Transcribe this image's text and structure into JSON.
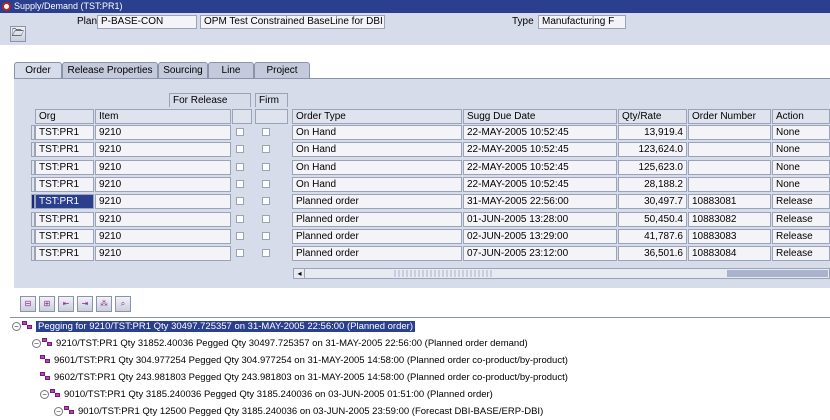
{
  "window": {
    "title": "Supply/Demand (TST:PR1)"
  },
  "header": {
    "plan_label": "Plan",
    "plan_value": "P-BASE-CON",
    "plan_desc": "OPM Test Constrained BaseLine for DBI",
    "type_label": "Type",
    "type_value": "Manufacturing F"
  },
  "tabs": [
    {
      "label": "Order",
      "active": true
    },
    {
      "label": "Release Properties",
      "active": false
    },
    {
      "label": "Sourcing",
      "active": false
    },
    {
      "label": "Line",
      "active": false
    },
    {
      "label": "Project",
      "active": false
    }
  ],
  "groups": {
    "for_release": "For Release",
    "firm": "Firm"
  },
  "columns": {
    "org": "Org",
    "item": "Item",
    "order_type": "Order Type",
    "sugg_due_date": "Sugg Due Date",
    "qty_rate": "Qty/Rate",
    "order_number": "Order Number",
    "action": "Action"
  },
  "rows": [
    {
      "org": "TST:PR1",
      "item": "9210",
      "order_type": "On Hand",
      "sugg_due_date": "22-MAY-2005 10:52:45",
      "qty_rate": "13,919.4",
      "order_number": "",
      "action": "None"
    },
    {
      "org": "TST:PR1",
      "item": "9210",
      "order_type": "On Hand",
      "sugg_due_date": "22-MAY-2005 10:52:45",
      "qty_rate": "123,624.0",
      "order_number": "",
      "action": "None"
    },
    {
      "org": "TST:PR1",
      "item": "9210",
      "order_type": "On Hand",
      "sugg_due_date": "22-MAY-2005 10:52:45",
      "qty_rate": "125,623.0",
      "order_number": "",
      "action": "None"
    },
    {
      "org": "TST:PR1",
      "item": "9210",
      "order_type": "On Hand",
      "sugg_due_date": "22-MAY-2005 10:52:45",
      "qty_rate": "28,188.2",
      "order_number": "",
      "action": "None"
    },
    {
      "org": "TST:PR1",
      "item": "9210",
      "order_type": "Planned order",
      "sugg_due_date": "31-MAY-2005 22:56:00",
      "qty_rate": "30,497.7",
      "order_number": "10883081",
      "action": "Release",
      "current": true
    },
    {
      "org": "TST:PR1",
      "item": "9210",
      "order_type": "Planned order",
      "sugg_due_date": "01-JUN-2005 13:28:00",
      "qty_rate": "50,450.4",
      "order_number": "10883082",
      "action": "Release"
    },
    {
      "org": "TST:PR1",
      "item": "9210",
      "order_type": "Planned order",
      "sugg_due_date": "02-JUN-2005 13:29:00",
      "qty_rate": "41,787.6",
      "order_number": "10883083",
      "action": "Release"
    },
    {
      "org": "TST:PR1",
      "item": "9210",
      "order_type": "Planned order",
      "sugg_due_date": "07-JUN-2005 23:12:00",
      "qty_rate": "36,501.6",
      "order_number": "10883084",
      "action": "Release"
    }
  ],
  "toolbar_icons": [
    "tree-collapse-icon",
    "tree-expand-icon",
    "pegging-up-icon",
    "pegging-down-icon",
    "pegging-all-icon",
    "pegging-find-icon"
  ],
  "tree": [
    {
      "text": "Pegging for 9210/TST:PR1 Qty 30497.725357 on 31-MAY-2005 22:56:00 (Planned order)",
      "level": 0,
      "expander": "−",
      "selected": true
    },
    {
      "text": "9210/TST:PR1 Qty 31852.40036 Pegged Qty 30497.725357 on 31-MAY-2005 22:56:00 (Planned order demand)",
      "level": 1,
      "expander": "−"
    },
    {
      "text": "9601/TST:PR1 Qty 304.977254 Pegged Qty 304.977254 on 31-MAY-2005 14:58:00 (Planned order co-product/by-product)",
      "level": 2,
      "expander": ""
    },
    {
      "text": "9602/TST:PR1 Qty 243.981803 Pegged Qty 243.981803 on 31-MAY-2005 14:58:00 (Planned order co-product/by-product)",
      "level": 2,
      "expander": ""
    },
    {
      "text": "9010/TST:PR1 Qty 3185.240036 Pegged Qty 3185.240036 on 03-JUN-2005 01:51:00 (Planned order)",
      "level": 2,
      "expander": "−"
    },
    {
      "text": "9010/TST:PR1 Qty 12500 Pegged Qty 3185.240036 on 03-JUN-2005 23:59:00 (Forecast DBI-BASE/ERP-DBI)",
      "level": 3,
      "expander": "−"
    }
  ]
}
